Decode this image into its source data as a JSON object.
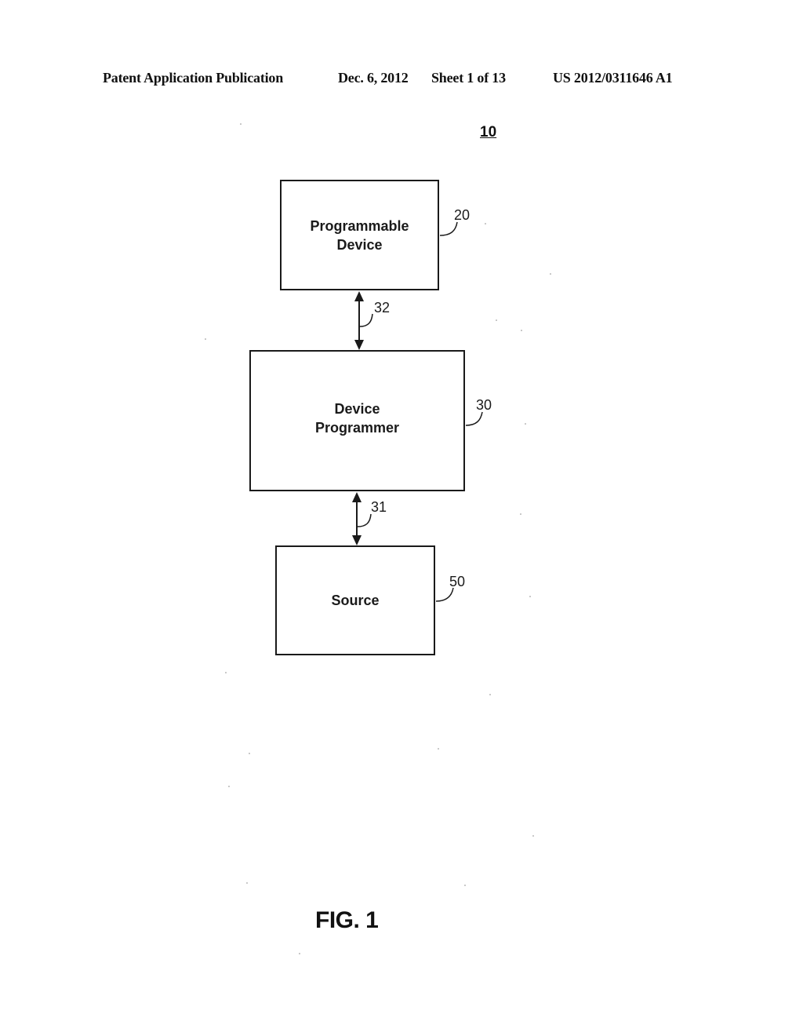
{
  "header": {
    "publication_type": "Patent Application Publication",
    "date": "Dec. 6, 2012",
    "sheet": "Sheet 1 of 13",
    "publication_number": "US 2012/0311646 A1"
  },
  "figure": {
    "system_ref": "10",
    "caption": "FIG. 1",
    "blocks": [
      {
        "id": "programmable-device",
        "label_lines": [
          "Programmable",
          "Device"
        ],
        "ref": "20"
      },
      {
        "id": "device-programmer",
        "label_lines": [
          "Device",
          "Programmer"
        ],
        "ref": "30"
      },
      {
        "id": "source",
        "label_lines": [
          "Source"
        ],
        "ref": "50"
      }
    ],
    "connections": [
      {
        "ref": "32",
        "from": "device-programmer",
        "to": "programmable-device",
        "direction": "bidirectional"
      },
      {
        "ref": "31",
        "from": "source",
        "to": "device-programmer",
        "direction": "bidirectional"
      }
    ]
  }
}
